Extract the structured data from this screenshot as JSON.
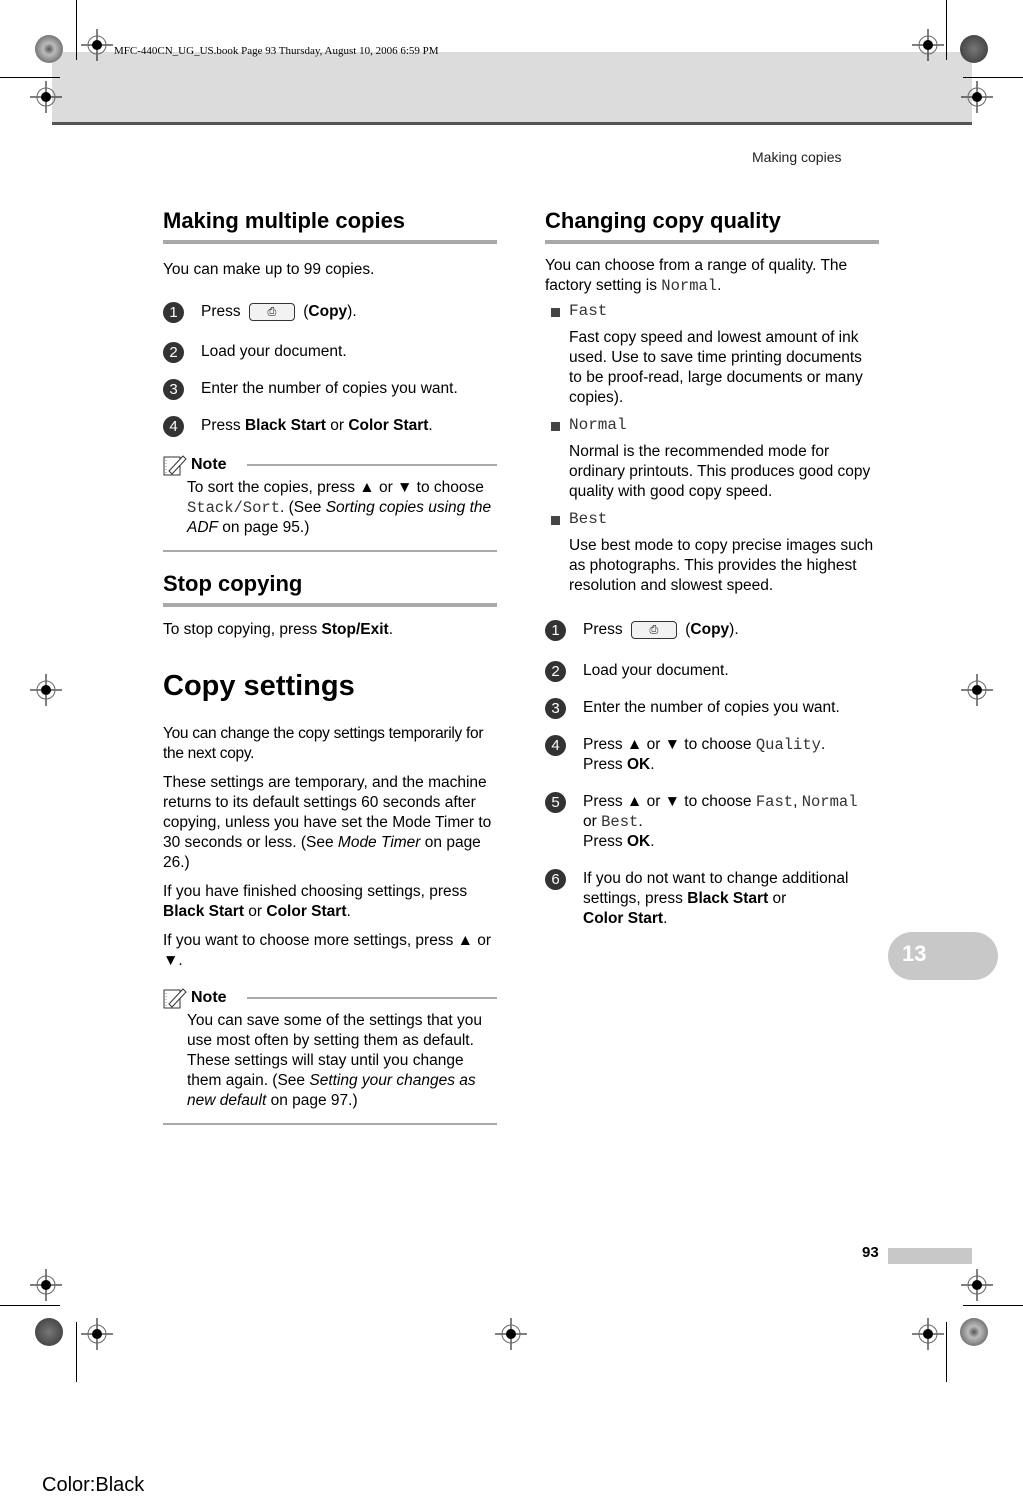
{
  "header": {
    "book_info": "MFC-440CN_UG_US.book  Page 93  Thursday, August 10, 2006  6:59 PM",
    "running_head": "Making copies"
  },
  "left": {
    "sec1_title": "Making multiple copies",
    "sec1_intro": "You can make up to 99 copies.",
    "steps": [
      {
        "n": "1",
        "pre": "Press ",
        "btn": "copy-key",
        "post_bold": "Copy",
        "post": ")."
      },
      {
        "n": "2",
        "text": "Load your document."
      },
      {
        "n": "3",
        "text": "Enter the number of copies you want."
      },
      {
        "n": "4",
        "pre": "Press ",
        "b1": "Black Start",
        "mid": " or ",
        "b2": "Color Start",
        "end": "."
      }
    ],
    "note1": {
      "label": "Note",
      "t1": "To sort the copies, press ▲ or ▼ to choose ",
      "mono": "Stack/Sort",
      "t2": ". (See ",
      "italic": "Sorting copies using the ADF",
      "t3": " on page 95.)"
    },
    "sec2_title": "Stop copying",
    "sec2_pre": "To stop copying, press ",
    "sec2_bold": "Stop/Exit",
    "sec2_end": ".",
    "sec3_title": "Copy settings",
    "sec3_p1": "You can change the copy settings temporarily for the next copy.",
    "sec3_p2_pre": "These settings are temporary, and the machine returns to its default settings 60 seconds after copying, unless you have set the Mode Timer to 30 seconds or less. (See ",
    "sec3_p2_italic": "Mode Timer",
    "sec3_p2_end": " on page 26.)",
    "sec3_p3_pre": "If you have finished choosing settings, press ",
    "sec3_p3_b1": "Black Start",
    "sec3_p3_mid": " or ",
    "sec3_p3_b2": "Color Start",
    "sec3_p3_end": ".",
    "sec3_p4": "If you want to choose more settings, press ▲ or ▼.",
    "note2": {
      "label": "Note",
      "t1": "You can save some of the settings that you use most often by setting them as default. These settings will stay until you change them again. (See ",
      "italic": "Setting your changes as new default",
      "t2": " on page 97.)"
    }
  },
  "right": {
    "title": "Changing copy quality",
    "intro_pre": "You can choose from a range of quality. The factory setting is ",
    "intro_mono": "Normal",
    "intro_end": ".",
    "options": [
      {
        "name": "Fast",
        "desc": "Fast copy speed and lowest amount of ink used. Use to save time printing documents to be proof-read, large documents or many copies)."
      },
      {
        "name": "Normal",
        "desc": "Normal is the recommended mode for ordinary printouts. This produces good copy quality with good copy speed."
      },
      {
        "name": "Best",
        "desc": "Use best mode to copy precise images such as photographs. This provides the highest resolution and slowest speed."
      }
    ],
    "steps": {
      "s1_pre": "Press ",
      "s1_bold": "Copy",
      "s1_end": ").",
      "s2": "Load your document.",
      "s3": "Enter the number of copies you want.",
      "s4_pre": "Press ▲ or ▼ to choose ",
      "s4_mono": "Quality",
      "s4_end": ".",
      "s4_l2_pre": "Press ",
      "s4_l2_bold": "OK",
      "s4_l2_end": ".",
      "s5_pre": "Press ▲ or ▼ to choose ",
      "s5_m1": "Fast",
      "s5_c": ", ",
      "s5_m2": "Normal",
      "s5_or": "or ",
      "s5_m3": "Best",
      "s5_end": ".",
      "s5_l3_pre": "Press ",
      "s5_l3_bold": "OK",
      "s5_l3_end": ".",
      "s6_pre": "If you do not want to change additional settings, press ",
      "s6_b1": "Black Start",
      "s6_mid": " or ",
      "s6_b2": "Color Start",
      "s6_end": "."
    }
  },
  "chapter_tab": "13",
  "page_number": "93",
  "color_label": "Color:Black",
  "copy_key_open": "(",
  "copy_key_glyph": "⎙"
}
